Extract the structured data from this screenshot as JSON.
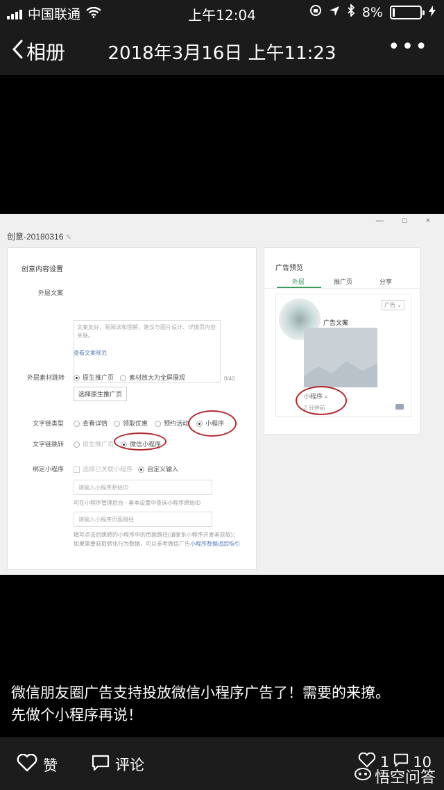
{
  "status_bar": {
    "carrier": "中国联通",
    "time": "上午12:04",
    "battery": "8%",
    "battery_level": 0.08
  },
  "nav": {
    "back_label": "相册",
    "title": "2018年3月16日 上午11:23",
    "more": "•••"
  },
  "photo": {
    "window_controls": "— □ ×",
    "window_title": "创意-20180316",
    "left_panel": {
      "heading": "创意内容设置",
      "outer_text_label": "外层文案",
      "outer_text_placeholder": "文案友好、易阅读和理解，建议与图片设计、详情页内容关联。",
      "char_count": "0/40",
      "guideline_link": "查看文案规范",
      "outer_jump_label": "外层素材跳转",
      "outer_jump_options": [
        "原生推广页",
        "素材放大为全屏展现"
      ],
      "select_page_button": "选择原生推广页",
      "link_type_label": "文字链类型",
      "link_type_options": [
        "查看详情",
        "领取优惠",
        "预约活动",
        "小程序"
      ],
      "link_jump_label": "文字链跳转",
      "link_jump_options": [
        "原生推广页",
        "微信小程序"
      ],
      "bind_label": "绑定小程序",
      "bind_options": [
        "选择已关联小程序",
        "自定义输入"
      ],
      "id_placeholder": "请输入小程序原始ID",
      "id_hint": "可在小程序管理后台 - 基本设置中查询小程序原始ID",
      "path_placeholder": "请输入小程序页面路径",
      "path_hint_1": "填写点击后跳转的小程序中的页面路径(请联系小程序开发者获取)；",
      "path_hint_2_prefix": "如果需要获取转化行为数据，可以参考微信广告",
      "path_hint_2_link": "小程序数据追踪指引"
    },
    "right_panel": {
      "heading": "广告预览",
      "tabs": [
        "外层",
        "推广页",
        "分享"
      ],
      "ad_badge": "广告",
      "ad_text": "广告文案",
      "mini_program": "小程序",
      "time_ago": "2 分钟前"
    }
  },
  "caption": {
    "line1": "微信朋友圈广告支持投放微信小程序广告了！需要的来撩。",
    "line2": "先做个小程序再说！"
  },
  "bottom_bar": {
    "like_label": "赞",
    "comment_label": "评论",
    "like_count": "1",
    "comment_count": "10",
    "watermark": "悟空问答"
  },
  "colors": {
    "bar_background": "#1b1b1b",
    "highlight_ring": "#b3272d",
    "link": "#5b7fb8"
  }
}
